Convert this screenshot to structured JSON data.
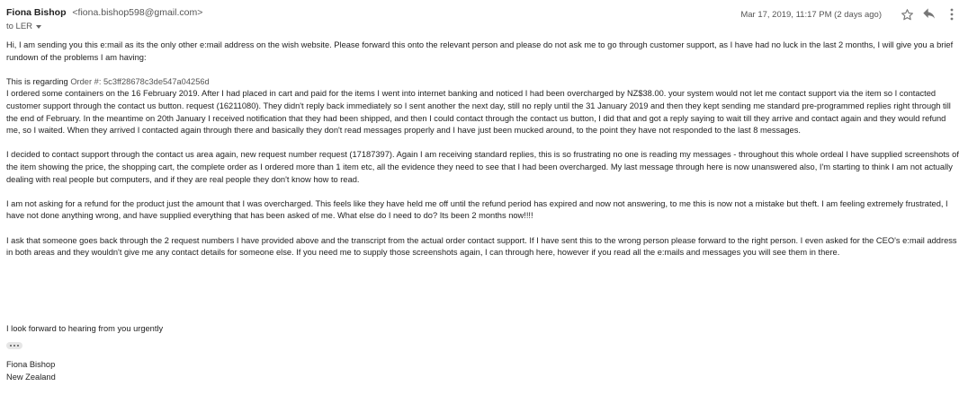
{
  "header": {
    "sender_name": "Fiona Bishop",
    "sender_email": "<fiona.bishop598@gmail.com>",
    "recipient": "to LER",
    "date": "Mar 17, 2019, 11:17 PM (2 days ago)",
    "icons": [
      "star-icon",
      "reply-icon",
      "more-vert-icon"
    ]
  },
  "body": {
    "greeting_para": "Hi, I am sending you this e:mail as its the only other e:mail address on the wish website.  Please forward this onto the relevant person and please do not ask me to go through customer support, as I have had no luck in the last 2 months, I will give you a brief rundown of the problems I am having:",
    "regarding_prefix": "This is regarding ",
    "order_reference": "Order #: 5c3ff28678c3de547a04256d",
    "story_para": "I ordered some containers on the 16 February 2019.  After I had placed in cart and paid for the items I went into internet banking and noticed I had been overcharged by NZ$38.00.  your system would not let me contact support via the item so I contacted customer support through the contact us button.  request (16211080).  They didn't reply back immediately so I sent another the next day, still no reply until the 31 January 2019 and then they kept sending me standard pre-programmed replies right through till the end of February.  In the meantime on 20th January I received notification that they had been shipped, and then I could contact through the contact us button, I did that and got a reply saying to wait till they arrive and contact again and they would refund me, so I waited.  When they arrived I contacted again through there and basically they don't read messages properly and I have just been mucked around, to the point they have not responded to the last 8 messages.",
    "second_request_para": "I decided to contact support through the contact us area again, new request number request (17187397).  Again I am receiving standard replies, this is so frustrating no one is reading my messages - throughout this whole ordeal I have supplied screenshots of the item showing the price, the shopping cart, the complete order as I ordered more than 1 item etc, all the evidence they need to see that I had been overcharged.  My last message through here is now unanswered also, I'm starting to think I am not actually dealing with real people but computers, and if they are real people they don't know how to read.",
    "refund_para": "I am not asking for a refund for the product just the amount that I was overcharged.  This feels like they have held me off until the refund period has expired and now not answering, to me this is now not a mistake but theft.  I am feeling extremely frustrated, I have not done anything wrong, and have supplied everything that has been asked of me.  What else do I need to do?  Its been 2 months now!!!!",
    "request_para": "I ask that someone goes back through the 2 request numbers I have provided above and the transcript from the actual order contact support.  If I have sent this to the wrong person please forward to the right person.  I even asked for the CEO's e:mail address in both areas and they wouldn't give me any contact details for someone else.  If you need me to supply those screenshots again, I can through here, however if you read all the e:mails and messages you will see them in there.",
    "closing": "I look forward to hearing from you urgently"
  },
  "signature": {
    "name": "Fiona Bishop",
    "location": "New Zealand"
  }
}
